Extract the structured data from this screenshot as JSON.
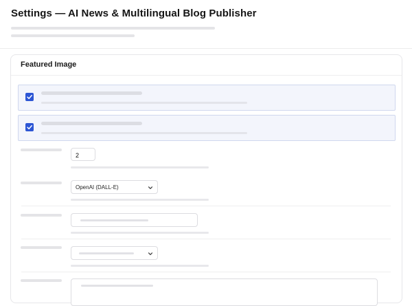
{
  "page": {
    "title": "Settings — AI News & Multilingual Blog Publisher"
  },
  "section": {
    "title": "Featured Image"
  },
  "fields": {
    "image_count": {
      "value": "2"
    },
    "provider": {
      "selected": "OpenAI (DALL-E)"
    }
  },
  "colors": {
    "accent": "#2d56d4",
    "highlight_bg": "#f3f5fc",
    "highlight_border": "#cfd7ee"
  },
  "icons": {
    "checkbox": "check-icon",
    "select": "chevron-down-icon"
  }
}
